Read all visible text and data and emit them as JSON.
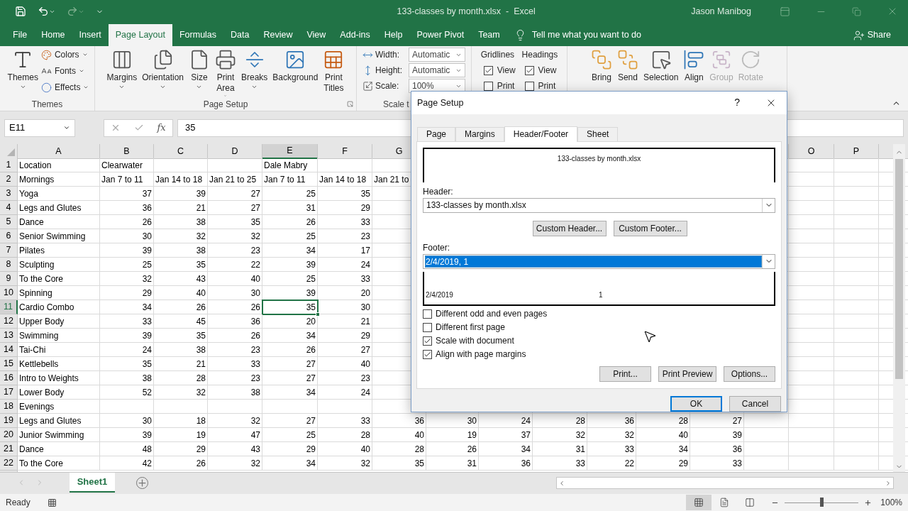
{
  "title_bar": {
    "title": "133-classes by month.xlsx  -  Excel",
    "user": "Jason Manibog"
  },
  "menu_tabs": [
    {
      "label": "File",
      "selected": false
    },
    {
      "label": "Home",
      "selected": false
    },
    {
      "label": "Insert",
      "selected": false
    },
    {
      "label": "Page Layout",
      "selected": true
    },
    {
      "label": "Formulas",
      "selected": false
    },
    {
      "label": "Data",
      "selected": false
    },
    {
      "label": "Review",
      "selected": false
    },
    {
      "label": "View",
      "selected": false
    },
    {
      "label": "Add-ins",
      "selected": false
    },
    {
      "label": "Help",
      "selected": false
    },
    {
      "label": "Power Pivot",
      "selected": false
    },
    {
      "label": "Team",
      "selected": false
    }
  ],
  "tell_me": {
    "placeholder": "Tell me what you want to do"
  },
  "share": "Share",
  "ribbon": {
    "groups": [
      {
        "label": "Themes",
        "items": [
          {
            "kind": "large",
            "label": "Themes",
            "dropdown": true,
            "disabled": false
          },
          {
            "kind": "stack",
            "items": [
              {
                "label": "Colors"
              },
              {
                "label": "Fonts"
              },
              {
                "label": "Effects"
              }
            ]
          }
        ]
      },
      {
        "label": "Page Setup",
        "launcher": true,
        "items": [
          {
            "kind": "large",
            "label": "Margins",
            "dropdown": true,
            "disabled": false
          },
          {
            "kind": "large",
            "label": "Orientation",
            "dropdown": true,
            "disabled": false
          },
          {
            "kind": "large",
            "label": "Size",
            "dropdown": true,
            "disabled": false
          },
          {
            "kind": "large",
            "label": "Print Area",
            "dropdown": true,
            "disabled": false
          },
          {
            "kind": "large",
            "label": "Breaks",
            "dropdown": true,
            "disabled": false
          },
          {
            "kind": "large",
            "label": "Background",
            "dropdown": false,
            "disabled": false
          },
          {
            "kind": "large",
            "label": "Print Titles",
            "dropdown": false,
            "disabled": false
          }
        ]
      },
      {
        "label": "Scale t",
        "items": [
          {
            "kind": "fields",
            "items": [
              {
                "label": "Width:",
                "value": "Automatic"
              },
              {
                "label": "Height:",
                "value": "Automatic"
              },
              {
                "label": "Scale:",
                "value": "100%"
              }
            ]
          }
        ]
      },
      {
        "items": [
          {
            "kind": "checks",
            "label": "Gridlines",
            "options": [
              {
                "label": "View",
                "checked": true
              },
              {
                "label": "Print",
                "checked": false
              }
            ]
          },
          {
            "kind": "checks",
            "label": "Headings",
            "options": [
              {
                "label": "View",
                "checked": true
              },
              {
                "label": "Print",
                "checked": false
              }
            ]
          }
        ]
      },
      {
        "items": [
          {
            "kind": "large",
            "label": "Bring",
            "dropdown": false,
            "disabled": false
          },
          {
            "kind": "large",
            "label": "Send",
            "dropdown": false,
            "disabled": false
          },
          {
            "kind": "large",
            "label": "Selection",
            "dropdown": false,
            "disabled": false
          },
          {
            "kind": "large",
            "label": "Align",
            "dropdown": false,
            "disabled": false
          },
          {
            "kind": "large",
            "label": "Group",
            "dropdown": false,
            "disabled": true
          },
          {
            "kind": "large",
            "label": "Rotate",
            "dropdown": false,
            "disabled": true
          }
        ]
      }
    ]
  },
  "formula_bar": {
    "name_box": "E11",
    "function_label": "fx",
    "value": "35"
  },
  "sheet": {
    "columns": [
      {
        "label": "A",
        "selected": false
      },
      {
        "label": "B",
        "selected": false
      },
      {
        "label": "C",
        "selected": false
      },
      {
        "label": "D",
        "selected": false
      },
      {
        "label": "E",
        "selected": true
      },
      {
        "label": "F",
        "selected": false
      },
      {
        "label": "G",
        "selected": false
      },
      null,
      null,
      null,
      null,
      null,
      null,
      null,
      {
        "label": "O",
        "selected": false
      },
      {
        "label": "P",
        "selected": false
      }
    ],
    "rows": [
      {
        "number": "1",
        "selected": false,
        "kind": "text",
        "cells": [
          "Location",
          "Clearwater",
          null,
          null,
          "Dale Mabry"
        ]
      },
      {
        "number": "2",
        "selected": false,
        "kind": "text",
        "cells": [
          "Mornings",
          "Jan 7 to 11",
          "Jan 14 to 18",
          "Jan 21 to 25",
          "Jan 7 to 11",
          "Jan 14 to 18",
          "Jan 21 to"
        ]
      },
      {
        "number": "3",
        "selected": false,
        "kind": "data",
        "cells": [
          "Yoga",
          "37",
          "39",
          "27",
          "25",
          "35"
        ]
      },
      {
        "number": "4",
        "selected": false,
        "kind": "data",
        "cells": [
          "Legs and Glutes",
          "36",
          "21",
          "27",
          "31",
          "29"
        ]
      },
      {
        "number": "5",
        "selected": false,
        "kind": "data",
        "cells": [
          "Dance",
          "26",
          "38",
          "35",
          "26",
          "33"
        ]
      },
      {
        "number": "6",
        "selected": false,
        "kind": "data",
        "cells": [
          "Senior Swimming",
          "30",
          "32",
          "32",
          "25",
          "23"
        ]
      },
      {
        "number": "7",
        "selected": false,
        "kind": "data",
        "cells": [
          "Pilates",
          "39",
          "38",
          "23",
          "34",
          "17"
        ]
      },
      {
        "number": "8",
        "selected": false,
        "kind": "data",
        "cells": [
          "Sculpting",
          "25",
          "35",
          "22",
          "39",
          "24"
        ]
      },
      {
        "number": "9",
        "selected": false,
        "kind": "data",
        "cells": [
          "To the Core",
          "32",
          "43",
          "40",
          "25",
          "33"
        ]
      },
      {
        "number": "10",
        "selected": false,
        "kind": "data",
        "cells": [
          "Spinning",
          "29",
          "40",
          "30",
          "39",
          "20"
        ]
      },
      {
        "number": "11",
        "selected": true,
        "kind": "data",
        "cells": [
          "Cardio Combo",
          "34",
          "26",
          "26",
          "35",
          "30"
        ]
      },
      {
        "number": "12",
        "selected": false,
        "kind": "data",
        "cells": [
          "Upper Body",
          "33",
          "45",
          "36",
          "20",
          "21"
        ]
      },
      {
        "number": "13",
        "selected": false,
        "kind": "data",
        "cells": [
          "Swimming",
          "39",
          "35",
          "26",
          "34",
          "29"
        ]
      },
      {
        "number": "14",
        "selected": false,
        "kind": "data",
        "cells": [
          "Tai-Chi",
          "24",
          "38",
          "23",
          "26",
          "27"
        ]
      },
      {
        "number": "15",
        "selected": false,
        "kind": "data",
        "cells": [
          "Kettlebells",
          "35",
          "21",
          "33",
          "27",
          "40"
        ]
      },
      {
        "number": "16",
        "selected": false,
        "kind": "data",
        "cells": [
          "Intro to Weights",
          "38",
          "28",
          "23",
          "27",
          "23"
        ]
      },
      {
        "number": "17",
        "selected": false,
        "kind": "data",
        "cells": [
          "Lower Body",
          "52",
          "32",
          "38",
          "34",
          "24"
        ]
      },
      {
        "number": "18",
        "selected": false,
        "kind": "text",
        "cells": [
          "Evenings"
        ]
      },
      {
        "number": "19",
        "selected": false,
        "kind": "data",
        "cells": [
          "Legs and Glutes",
          "30",
          "18",
          "32",
          "27",
          "33",
          "36",
          "30",
          "24",
          "28",
          "36",
          "28",
          "27"
        ]
      },
      {
        "number": "20",
        "selected": false,
        "kind": "data",
        "cells": [
          "Junior Swimming",
          "39",
          "19",
          "47",
          "25",
          "28",
          "40",
          "19",
          "37",
          "32",
          "32",
          "40",
          "39"
        ]
      },
      {
        "number": "21",
        "selected": false,
        "kind": "data",
        "cells": [
          "Dance",
          "48",
          "29",
          "43",
          "29",
          "40",
          "28",
          "26",
          "34",
          "31",
          "33",
          "34",
          "36"
        ]
      },
      {
        "number": "22",
        "selected": false,
        "kind": "data",
        "cells": [
          "To the Core",
          "42",
          "26",
          "32",
          "34",
          "32",
          "35",
          "31",
          "36",
          "33",
          "22",
          "29",
          "33"
        ]
      }
    ]
  },
  "sheet_tabs": [
    {
      "label": "Sheet1",
      "selected": true
    }
  ],
  "status_bar": {
    "text": "Ready",
    "views": [
      {
        "kind": "normal",
        "selected": true
      },
      {
        "kind": "page-layout",
        "selected": false
      },
      {
        "kind": "page-break",
        "selected": false
      }
    ],
    "zoom": {
      "level": 0.5,
      "reading": "100%"
    }
  },
  "dialog": {
    "title": "Page Setup",
    "help": "?",
    "tabs": [
      {
        "label": "Page",
        "selected": false
      },
      {
        "label": "Margins",
        "selected": false
      },
      {
        "label": "Header/Footer",
        "selected": true
      },
      {
        "label": "Sheet",
        "selected": false
      }
    ],
    "header_preview": "133-classes by month.xlsx",
    "header": {
      "label": "Header:",
      "value": "133-classes by month.xlsx",
      "selected": false
    },
    "custom_buttons": [
      "Custom Header...",
      "Custom Footer..."
    ],
    "footer": {
      "label": "Footer:",
      "value": "2/4/2019, 1",
      "selected": true
    },
    "footer_preview": {
      "left": "2/4/2019",
      "center": "1"
    },
    "options": [
      {
        "label": "Different odd and even pages",
        "checked": false
      },
      {
        "label": "Different first page",
        "checked": false
      },
      {
        "label": "Scale with document",
        "checked": true
      },
      {
        "label": "Align with page margins",
        "checked": true
      }
    ],
    "action_buttons": [
      "Print...",
      "Print Preview",
      "Options..."
    ],
    "buttons": [
      {
        "label": "OK",
        "default": true
      },
      {
        "label": "Cancel",
        "default": false
      }
    ]
  }
}
